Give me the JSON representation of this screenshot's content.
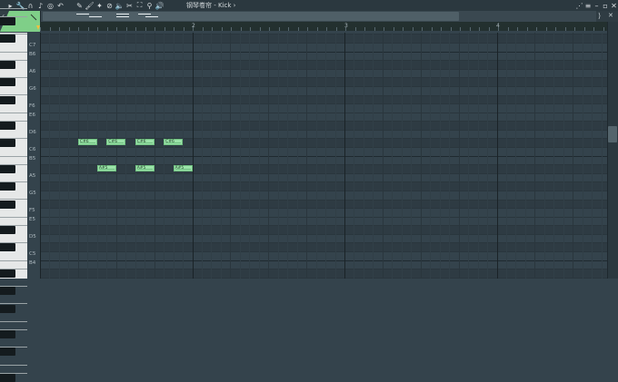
{
  "window": {
    "title": "钢琴卷帘 - Kick",
    "title_arrow": "›"
  },
  "toolbar": {
    "left": [
      {
        "icon": "play-triangle-icon",
        "glyph": "▸"
      },
      {
        "icon": "wrench-icon",
        "glyph": "🔧"
      },
      {
        "icon": "magnet-icon",
        "glyph": "∩"
      },
      {
        "icon": "note-icon",
        "glyph": "♪"
      },
      {
        "icon": "target-icon",
        "glyph": "◎"
      },
      {
        "icon": "undo-icon",
        "glyph": "↶"
      }
    ],
    "tools": [
      {
        "icon": "pencil-icon",
        "glyph": "✎"
      },
      {
        "icon": "brush-icon",
        "glyph": "🖌"
      },
      {
        "icon": "wand-icon",
        "glyph": "✦"
      },
      {
        "icon": "delete-icon",
        "glyph": "⊘"
      },
      {
        "icon": "mute-icon",
        "glyph": "🔈"
      },
      {
        "icon": "slip-icon",
        "glyph": "✂"
      },
      {
        "icon": "select-icon",
        "glyph": "⛶"
      },
      {
        "icon": "zoom-icon",
        "glyph": "⚲"
      },
      {
        "icon": "playback-icon",
        "glyph": "🔊"
      }
    ],
    "right": [
      {
        "icon": "snap-icon",
        "glyph": "⋰"
      },
      {
        "icon": "menu-icon",
        "glyph": "≡"
      },
      {
        "icon": "minimize-icon",
        "glyph": "–"
      },
      {
        "icon": "maximize-icon",
        "glyph": "▫"
      },
      {
        "icon": "close-icon",
        "glyph": "✕"
      }
    ]
  },
  "overview": {
    "left_arrow": "‹",
    "right_buttons": [
      "⟩",
      "✕"
    ]
  },
  "ruler": {
    "bars": [
      "2",
      "3",
      "4"
    ]
  },
  "keyboard": {
    "c_labels": [
      "C7",
      "C6",
      "C5"
    ]
  },
  "notes": [
    {
      "label": "C#6",
      "pitch": "C#6",
      "start": 0.25,
      "length": 0.125
    },
    {
      "label": "C#6",
      "pitch": "C#6",
      "start": 0.4375,
      "length": 0.125
    },
    {
      "label": "C#6",
      "pitch": "C#6",
      "start": 0.625,
      "length": 0.125
    },
    {
      "label": "C#6",
      "pitch": "C#6",
      "start": 0.8125,
      "length": 0.125
    },
    {
      "label": "A#5",
      "pitch": "A#5",
      "start": 0.375,
      "length": 0.125
    },
    {
      "label": "A#5",
      "pitch": "A#5",
      "start": 0.625,
      "length": 0.125
    },
    {
      "label": "A#5",
      "pitch": "A#5",
      "start": 0.875,
      "length": 0.125
    }
  ],
  "colors": {
    "note_fill": "#9be3a9",
    "grid_bg": "#34434c",
    "accent_green": "#7fcf88"
  }
}
